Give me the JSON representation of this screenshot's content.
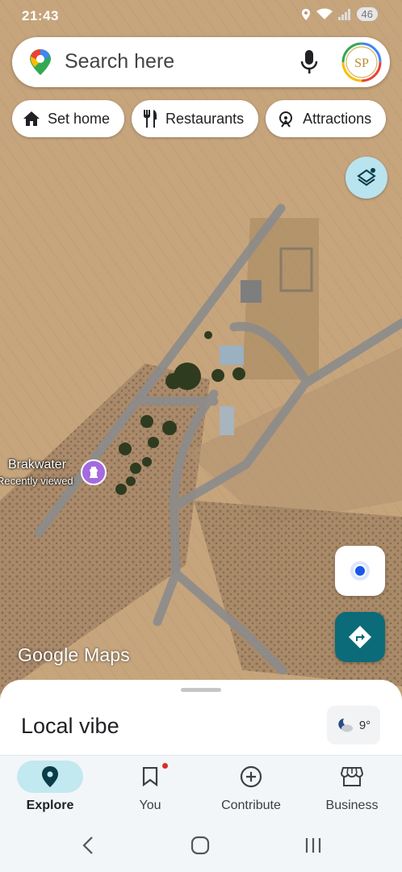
{
  "status_bar": {
    "time": "21:43",
    "battery": "46"
  },
  "search": {
    "placeholder": "Search here",
    "avatar_initials": "SP"
  },
  "chips": [
    {
      "label": "Set home",
      "icon": "home-icon"
    },
    {
      "label": "Restaurants",
      "icon": "restaurant-icon"
    },
    {
      "label": "Attractions",
      "icon": "attractions-icon"
    }
  ],
  "map": {
    "place": {
      "name": "Brakwater",
      "subtitle": "Recently viewed",
      "icon": "monument-icon"
    },
    "watermark": "Google Maps"
  },
  "sheet": {
    "title": "Local vibe",
    "temperature": "9°",
    "weather_icon": "moon-cloud-icon"
  },
  "nav": [
    {
      "label": "Explore",
      "icon": "location-pin-icon",
      "active": true
    },
    {
      "label": "You",
      "icon": "bookmark-icon",
      "active": false,
      "notification": true
    },
    {
      "label": "Contribute",
      "icon": "add-circle-icon",
      "active": false
    },
    {
      "label": "Business",
      "icon": "storefront-icon",
      "active": false
    }
  ],
  "colors": {
    "accent": "#0b6b78",
    "active_nav": "#c2e8f0",
    "place_icon": "#a56ae0",
    "location_dot": "#1a56e8"
  }
}
